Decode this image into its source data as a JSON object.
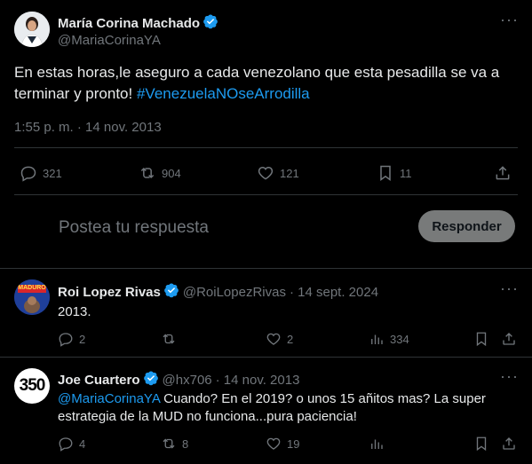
{
  "main_tweet": {
    "author_name": "María Corina Machado",
    "handle": "@MariaCorinaYA",
    "text_plain": "En estas horas,le aseguro a cada venezolano que esta pesadilla se va a terminar y pronto!",
    "hashtag": "#VenezuelaNOseArrodilla",
    "timestamp": "1:55 p. m. · 14 nov. 2013",
    "stats": {
      "replies": "321",
      "retweets": "904",
      "likes": "121",
      "bookmarks": "11"
    }
  },
  "reply_box": {
    "placeholder": "Postea tu respuesta",
    "button_label": "Responder"
  },
  "replies": [
    {
      "author_name": "Roi Lopez Rivas",
      "handle": "@RoiLopezRivas",
      "date": "· 14 sept. 2024",
      "text": "2013.",
      "avatar_label": "MADURO",
      "stats": {
        "replies": "2",
        "retweets": "",
        "likes": "2",
        "views": "334"
      }
    },
    {
      "author_name": "Joe Cuartero",
      "handle": "@hx706",
      "date": "· 14 nov. 2013",
      "mention": "@MariaCorinaYA",
      "text": " Cuando? En el 2019? o unos 15 añitos mas? La super estrategia de la MUD no funciona...pura paciencia!",
      "avatar_label": "350",
      "stats": {
        "replies": "4",
        "retweets": "8",
        "likes": "19",
        "views": ""
      }
    }
  ],
  "colors": {
    "accent": "#1d9bf0",
    "muted": "#71767b",
    "text": "#e7e9ea",
    "divider": "#2f3336"
  }
}
